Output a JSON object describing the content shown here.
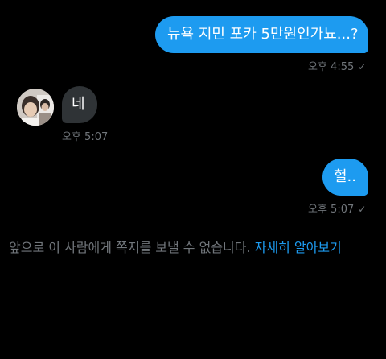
{
  "messages": [
    {
      "direction": "sent",
      "text": "뉴욕 지민 포카 5만원인가뇨...?",
      "time": "오후 4:55",
      "status_icon": "check-icon"
    },
    {
      "direction": "received",
      "text": "네",
      "time": "오후 5:07",
      "avatar_icon": "user-avatar"
    },
    {
      "direction": "sent",
      "text": "헐..",
      "time": "오후 5:07",
      "status_icon": "check-icon"
    }
  ],
  "check_glyph": "✓",
  "notice": {
    "text": "앞으로 이 사람에게 쪽지를 보낼 수 없습니다.",
    "link": "자세히 알아보기"
  },
  "colors": {
    "background": "#000000",
    "sent_bubble": "#1d9bf0",
    "received_bubble": "#2f3336",
    "link": "#1d9bf0",
    "muted": "#71767b"
  }
}
